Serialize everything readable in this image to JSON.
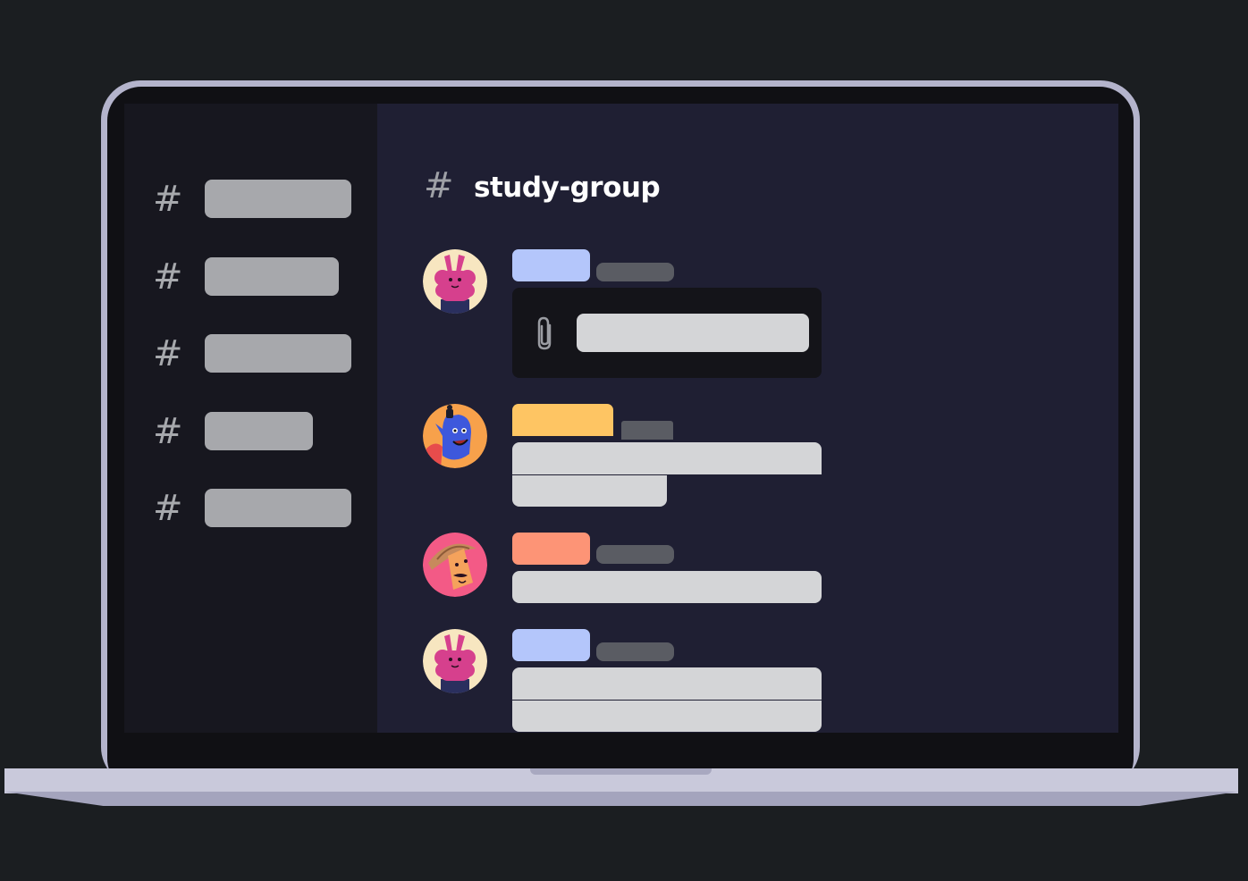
{
  "channel": {
    "name": "study-group",
    "hash_symbol": "#"
  },
  "sidebar": {
    "items": [
      {
        "hash": "#"
      },
      {
        "hash": "#"
      },
      {
        "hash": "#"
      },
      {
        "hash": "#"
      },
      {
        "hash": "#"
      }
    ]
  },
  "messages": [
    {
      "author_color": "#b4c6fb",
      "avatar": "pink-bunny-avatar-icon",
      "attachment": true
    },
    {
      "author_color": "#fec563",
      "avatar": "blue-genie-avatar-icon"
    },
    {
      "author_color": "#fd9476",
      "avatar": "hat-character-avatar-icon"
    },
    {
      "author_color": "#b4c6fb",
      "avatar": "pink-bunny-avatar-icon"
    }
  ],
  "colors": {
    "background": "#1b1e21",
    "sidebar": "#17171f",
    "chat": "#1f1f33",
    "placeholder": "#d4d5d7"
  }
}
